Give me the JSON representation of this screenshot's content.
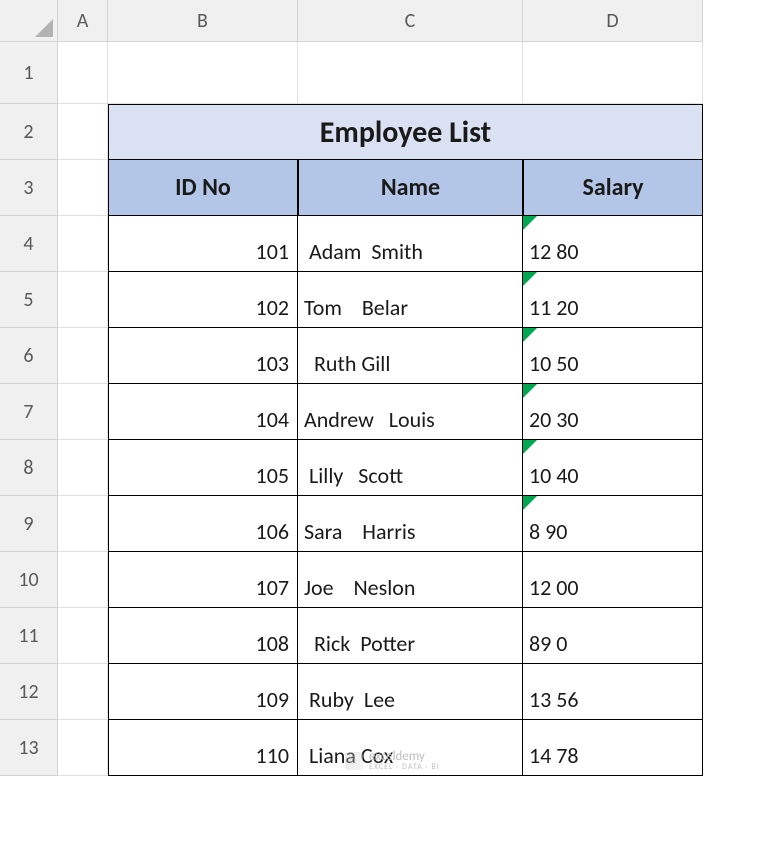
{
  "columns": [
    "A",
    "B",
    "C",
    "D"
  ],
  "rows": [
    "1",
    "2",
    "3",
    "4",
    "5",
    "6",
    "7",
    "8",
    "9",
    "10",
    "11",
    "12",
    "13"
  ],
  "title": "Employee List",
  "headers": {
    "id": "ID No",
    "name": "Name",
    "salary": "Salary"
  },
  "data": [
    {
      "id": "101",
      "name": " Adam  Smith",
      "salary": "12 80",
      "err": true
    },
    {
      "id": "102",
      "name": "Tom    Belar",
      "salary": "11 20",
      "err": true
    },
    {
      "id": "103",
      "name": "  Ruth Gill",
      "salary": "10 50",
      "err": true
    },
    {
      "id": "104",
      "name": "Andrew   Louis",
      "salary": "20 30",
      "err": true
    },
    {
      "id": "105",
      "name": " Lilly   Scott",
      "salary": "10 40",
      "err": true
    },
    {
      "id": "106",
      "name": "Sara    Harris",
      "salary": "8 90",
      "err": true
    },
    {
      "id": "107",
      "name": "Joe    Neslon",
      "salary": "12 00",
      "err": false
    },
    {
      "id": "108",
      "name": "  Rick  Potter",
      "salary": "89 0",
      "err": false
    },
    {
      "id": "109",
      "name": " Ruby  Lee",
      "salary": "13 56",
      "err": false
    },
    {
      "id": "110",
      "name": " Liana Cox",
      "salary": "14 78",
      "err": false
    }
  ],
  "watermark": {
    "brand": "exceldemy",
    "tagline": "EXCEL · DATA · BI"
  }
}
